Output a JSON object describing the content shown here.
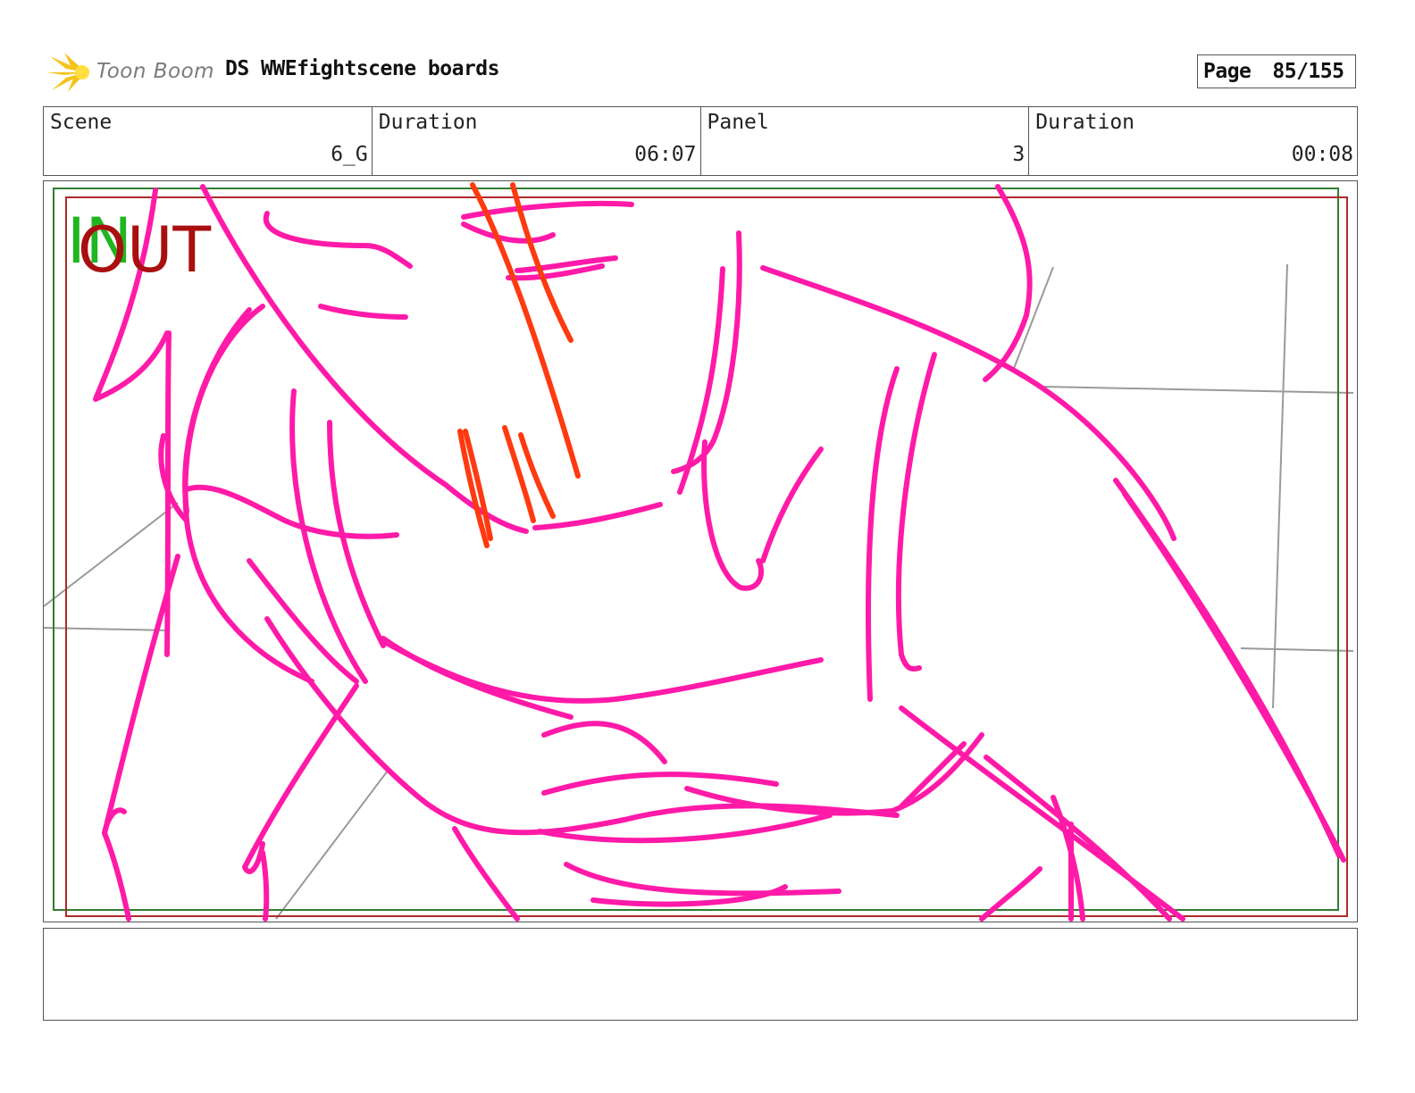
{
  "header": {
    "logo_text": "Toon Boom",
    "project_title": "DS WWEfightscene boards",
    "page_label": "Page",
    "page_value": "85/155"
  },
  "info": {
    "scene_label": "Scene",
    "scene_value": "6_G",
    "scene_duration_label": "Duration",
    "scene_duration_value": "06:07",
    "panel_label": "Panel",
    "panel_value": "3",
    "panel_duration_label": "Duration",
    "panel_duration_value": "00:08"
  },
  "panel": {
    "in_marker": "IN",
    "out_marker": "OUT",
    "colors": {
      "sketch_main": "#ff1aa8",
      "sketch_accent": "#ff3a10",
      "guide_lines": "#9a9a9a",
      "safe_frame_green": "#2f7d2f",
      "safe_frame_red": "#b02a2a"
    }
  },
  "notes": {
    "text": ""
  }
}
